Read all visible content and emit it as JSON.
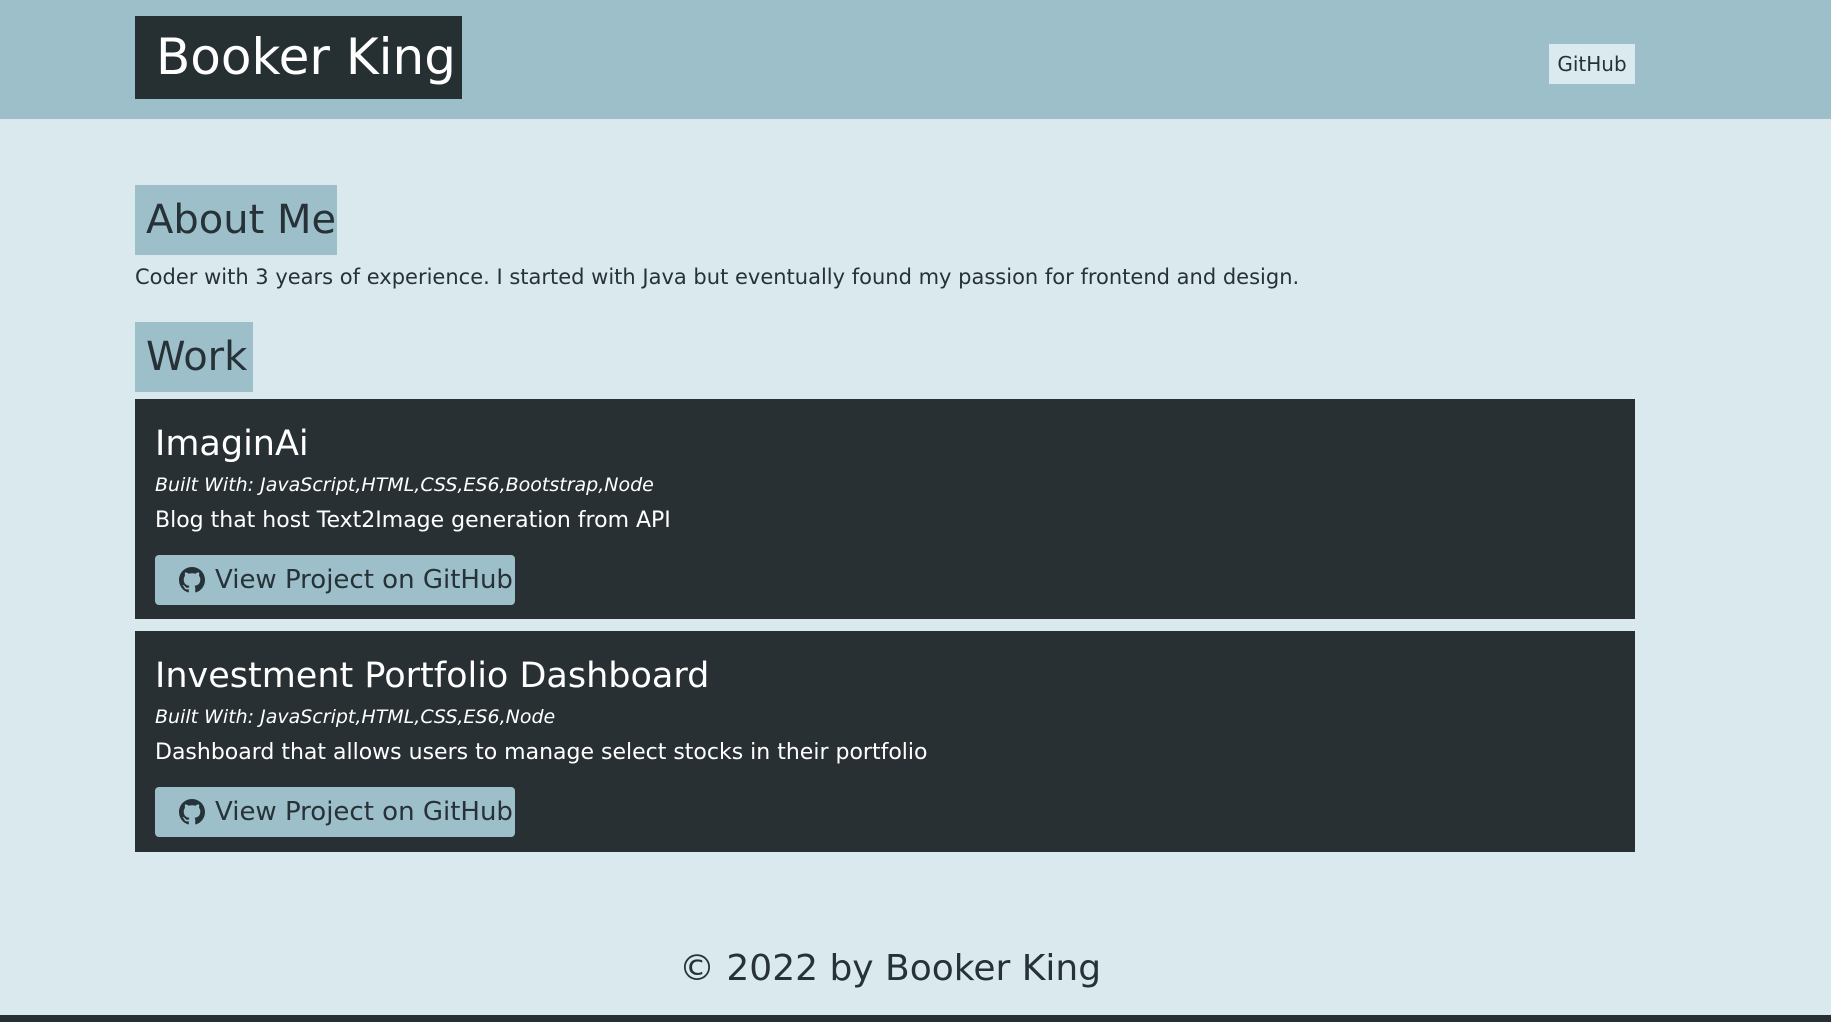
{
  "header": {
    "brand": "Booker King",
    "nav_github": "GitHub"
  },
  "about": {
    "heading": "About Me",
    "text": "Coder with 3 years of experience. I started with Java but eventually found my passion for frontend and design."
  },
  "work": {
    "heading": "Work",
    "projects": [
      {
        "title": "ImaginAi",
        "built_with": "Built With: JavaScript,HTML,CSS,ES6,Bootstrap,Node",
        "description": "Blog that host Text2Image generation from API",
        "button_label": "View Project on GitHub",
        "button_icon": "github-icon"
      },
      {
        "title": "Investment Portfolio Dashboard",
        "built_with": "Built With: JavaScript,HTML,CSS,ES6,Node",
        "description": "Dashboard that allows users to manage select stocks in their portfolio",
        "button_label": "View Project on GitHub",
        "button_icon": "github-icon"
      }
    ]
  },
  "footer": {
    "text": "© 2022 by Booker King"
  },
  "colors": {
    "page_background": "#d9e9ee",
    "header_background": "#9dbfc9",
    "dark": "#283034",
    "accent": "#9dbfc9",
    "text": "#263238"
  }
}
